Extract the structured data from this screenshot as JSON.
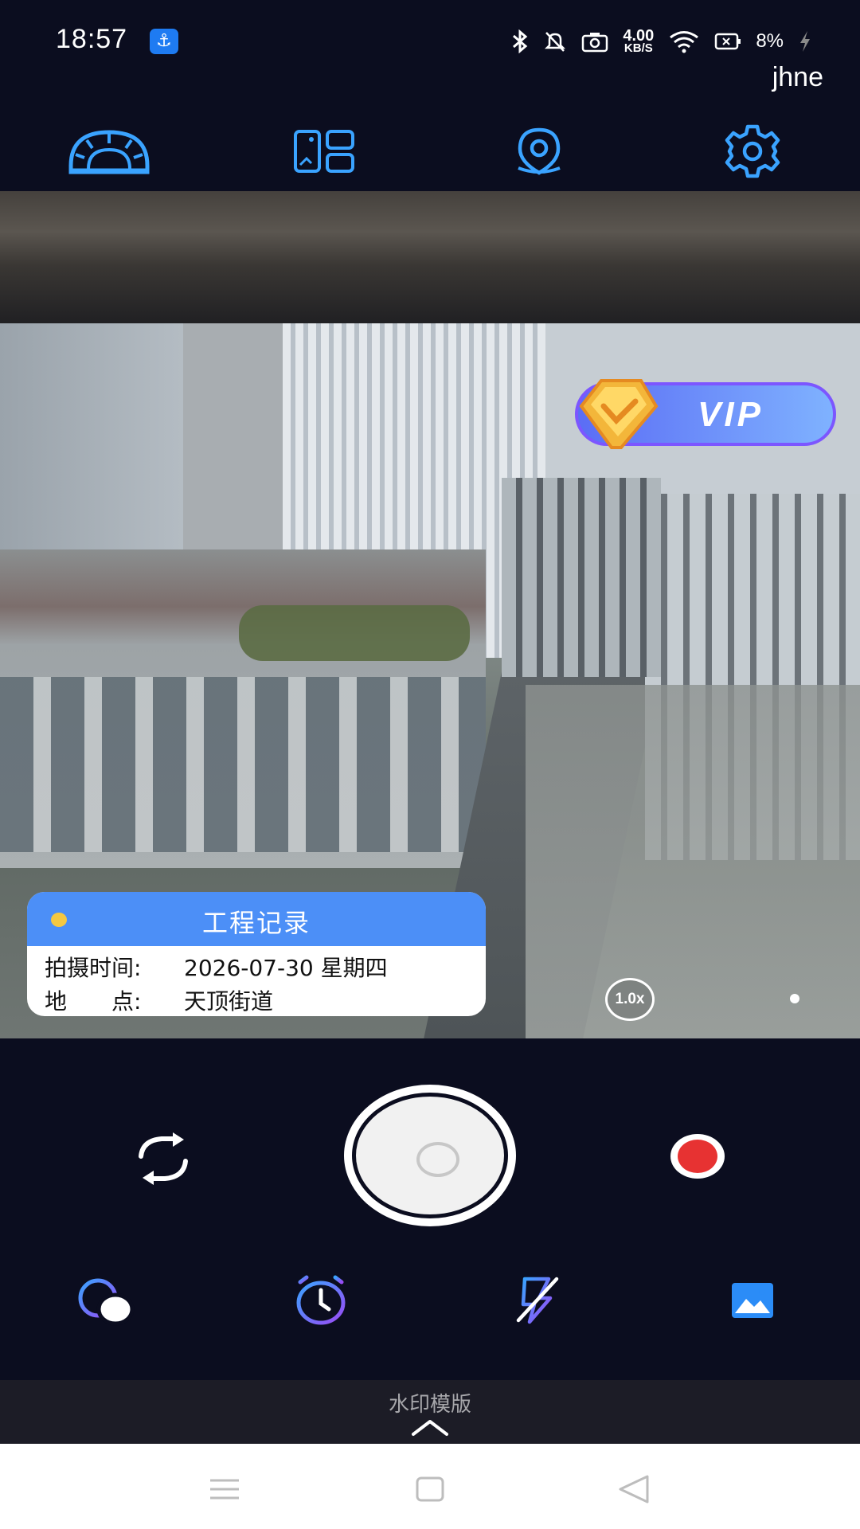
{
  "status_bar": {
    "time": "18:57",
    "usb_icon": "usb-icon",
    "net_speed_value": "4.00",
    "net_speed_unit": "KB/S",
    "battery_percent": "8%",
    "icons": [
      "bluetooth-icon",
      "mute-bell-icon",
      "camera-icon",
      "wifi-icon",
      "battery-icon",
      "charging-icon"
    ]
  },
  "user": {
    "name": "jhne"
  },
  "toolbar": {
    "items": [
      {
        "icon": "protractor-icon"
      },
      {
        "icon": "layout-grid-icon"
      },
      {
        "icon": "location-pin-icon"
      },
      {
        "icon": "gear-icon"
      }
    ]
  },
  "vip": {
    "label": "VIP"
  },
  "watermark": {
    "title": "工程记录",
    "time_label": "拍摄时间:",
    "time_value": "2026-07-30 星期四",
    "place_label": "地　　点:",
    "place_value": "天顶街道"
  },
  "zoom": {
    "level": "1.0x"
  },
  "bottom_tools": [
    "filter-circles-icon",
    "timer-icon",
    "flash-off-icon",
    "gallery-icon"
  ],
  "template_bar": {
    "label": "水印模版"
  },
  "colors": {
    "accent_blue": "#4c8ff7",
    "icon_blue": "#3aa3ff",
    "record_red": "#e73232",
    "background": "#0b0d1f"
  }
}
